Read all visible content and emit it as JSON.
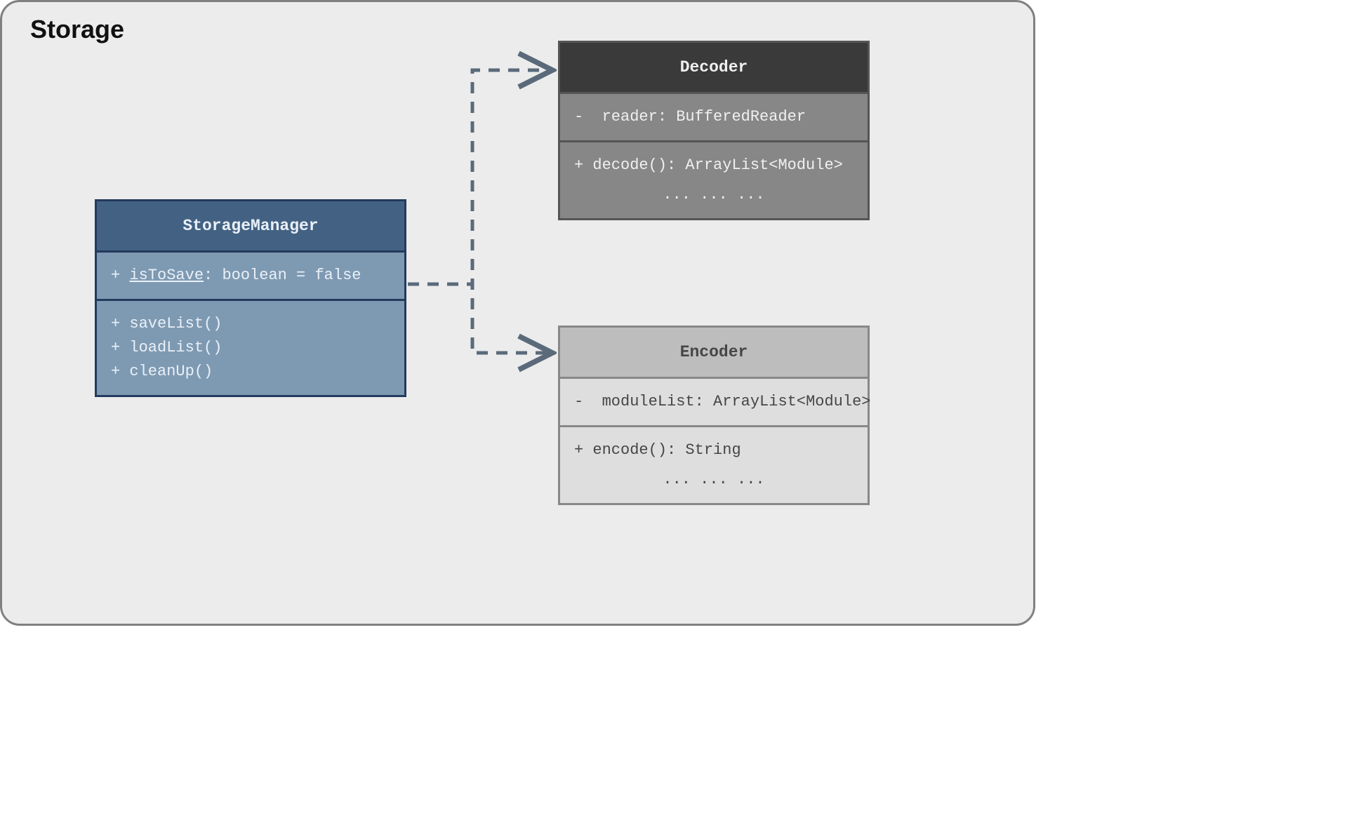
{
  "package": {
    "name": "Storage"
  },
  "classes": {
    "storageManager": {
      "name": "StorageManager",
      "attributes": [
        {
          "visibility": "+",
          "name": "isToSave",
          "type": "boolean",
          "default": "false",
          "static": true
        }
      ],
      "methods": [
        {
          "visibility": "+",
          "signature": "saveList()"
        },
        {
          "visibility": "+",
          "signature": "loadList()"
        },
        {
          "visibility": "+",
          "signature": "cleanUp()"
        }
      ]
    },
    "decoder": {
      "name": "Decoder",
      "attributes": [
        {
          "visibility": "-",
          "name": "reader",
          "type": "BufferedReader"
        }
      ],
      "methods": [
        {
          "visibility": "+",
          "signature": "decode(): ArrayList<Module>"
        }
      ],
      "ellipsis": "... ... ..."
    },
    "encoder": {
      "name": "Encoder",
      "attributes": [
        {
          "visibility": "-",
          "name": "moduleList",
          "type": "ArrayList<Module>"
        }
      ],
      "methods": [
        {
          "visibility": "+",
          "signature": "encode(): String"
        }
      ],
      "ellipsis": "... ... ..."
    }
  },
  "relationships": [
    {
      "from": "StorageManager",
      "to": "Decoder",
      "type": "dependency"
    },
    {
      "from": "StorageManager",
      "to": "Encoder",
      "type": "dependency"
    }
  ]
}
